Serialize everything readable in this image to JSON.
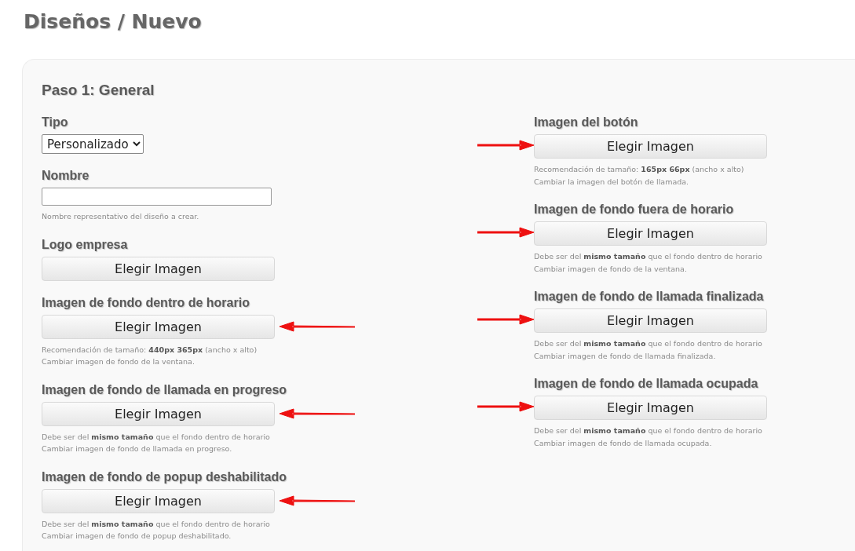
{
  "page_title": "Diseños / Nuevo",
  "step_title": "Paso 1: General",
  "columns": [
    [
      {
        "kind": "select",
        "label": "Tipo",
        "value": "Personalizado"
      },
      {
        "kind": "text",
        "label": "Nombre",
        "help": [
          "Nombre representativo del diseño a crear."
        ]
      },
      {
        "kind": "image",
        "label": "Logo empresa",
        "button": "Elegir Imagen"
      },
      {
        "kind": "image",
        "label": "Imagen de fondo dentro de horario",
        "button": "Elegir Imagen",
        "help": [
          "Recomendación de tamaño: **440px 365px** (ancho x alto)",
          "Cambiar imagen de fondo de la ventana."
        ],
        "arrow": true
      },
      {
        "kind": "image",
        "label": "Imagen de fondo de llamada en progreso",
        "button": "Elegir Imagen",
        "help": [
          "Debe ser del **mismo tamaño** que el fondo dentro de horario",
          "Cambiar imagen de fondo de llamada en progreso."
        ],
        "arrow": true
      },
      {
        "kind": "image",
        "label": "Imagen de fondo de popup deshabilitado",
        "button": "Elegir Imagen",
        "help": [
          "Debe ser del **mismo tamaño** que el fondo dentro de horario",
          "Cambiar imagen de fondo de popup deshabilitado."
        ],
        "arrow": true
      }
    ],
    [
      {
        "kind": "image",
        "label": "Imagen del botón",
        "button": "Elegir Imagen",
        "help": [
          "Recomendación de tamaño: **165px 66px** (ancho x alto)",
          "Cambiar la imagen del botón de llamada."
        ],
        "arrow": true
      },
      {
        "kind": "image",
        "label": "Imagen de fondo fuera de horario",
        "button": "Elegir Imagen",
        "help": [
          "Debe ser del **mismo tamaño** que el fondo dentro de horario",
          "Cambiar imagen de fondo de la ventana."
        ],
        "arrow": true
      },
      {
        "kind": "image",
        "label": "Imagen de fondo de llamada finalizada",
        "button": "Elegir Imagen",
        "help": [
          "Debe ser del **mismo tamaño** que el fondo dentro de horario",
          "Cambiar imagen de fondo de llamada finalizada."
        ],
        "arrow": true
      },
      {
        "kind": "image",
        "label": "Imagen de fondo de llamada ocupada",
        "button": "Elegir Imagen",
        "help": [
          "Debe ser del **mismo tamaño** que el fondo dentro de horario",
          "Cambiar imagen de fondo de llamada ocupada."
        ],
        "arrow": true
      }
    ]
  ]
}
